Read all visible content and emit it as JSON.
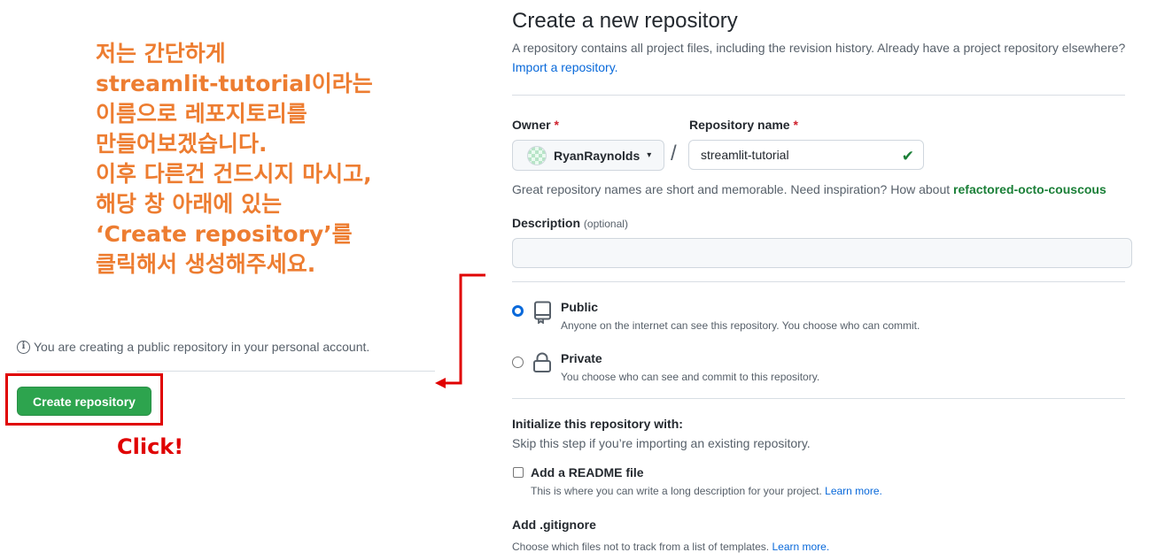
{
  "annotation": {
    "lines": [
      "저는 간단하게",
      "streamlit-tutorial이라는",
      "이름으로 레포지토리를",
      "만들어보겠습니다.",
      "이후 다른건 건드시지 마시고,",
      "해당 창 아래에 있는",
      "‘Create repository’를",
      "클릭해서 생성해주세요."
    ],
    "click_label": "Click!",
    "colors": {
      "note": "#ed7d31",
      "highlight": "#e00000"
    }
  },
  "footer": {
    "info_text": "You are creating a public repository in your personal account.",
    "info_icon": "i",
    "create_button": "Create repository"
  },
  "form": {
    "title": "Create a new repository",
    "subtitle": "A repository contains all project files, including the revision history. Already have a project repository elsewhere?",
    "import_link": "Import a repository.",
    "owner_label": "Owner",
    "repo_name_label": "Repository name",
    "required_mark": "*",
    "owner_value": "RyanRaynolds",
    "owner_caret": "▾",
    "separator": "/",
    "repo_name_value": "streamlit-tutorial",
    "valid_icon": "✔",
    "suggestion_prefix": "Great repository names are short and memorable. Need inspiration? How about ",
    "suggestion_name": "refactored-octo-couscous",
    "description_label": "Description",
    "description_optional": "(optional)",
    "description_value": "",
    "visibility": {
      "public": {
        "title": "Public",
        "desc": "Anyone on the internet can see this repository. You choose who can commit.",
        "selected": true
      },
      "private": {
        "title": "Private",
        "desc": "You choose who can see and commit to this repository.",
        "selected": false
      }
    },
    "init_title": "Initialize this repository with:",
    "init_sub": "Skip this step if you’re importing an existing repository.",
    "readme_title": "Add a README file",
    "readme_desc": "This is where you can write a long description for your project. ",
    "readme_link": "Learn more.",
    "gitignore_title": "Add .gitignore",
    "gitignore_desc": "Choose which files not to track from a list of templates. ",
    "gitignore_link": "Learn more."
  }
}
